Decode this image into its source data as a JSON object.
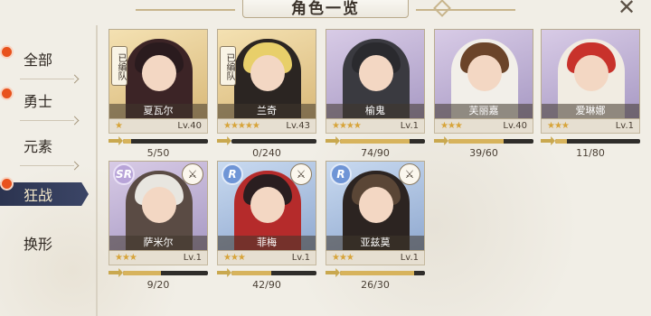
{
  "title": "角色一览",
  "close_icon": "close-icon",
  "sidebar": {
    "items": [
      {
        "label": "全部",
        "dot": true,
        "active": false
      },
      {
        "label": "勇士",
        "dot": true,
        "active": false
      },
      {
        "label": "元素",
        "dot": false,
        "active": false
      },
      {
        "label": "狂战",
        "dot": true,
        "active": true
      },
      {
        "label": "换形",
        "dot": false,
        "active": false
      }
    ]
  },
  "badge_text": "已编队",
  "characters": [
    {
      "name": "夏瓦尔",
      "stars": "★",
      "level": "Lv.40",
      "count": "5/50",
      "progress": 0.1,
      "formed": true,
      "frame": "gold",
      "rarity": "",
      "class_icon": false,
      "hair": "#2a1b1e",
      "outfit": "#3c2426"
    },
    {
      "name": "兰奇",
      "stars": "★★★★★",
      "level": "Lv.43",
      "count": "0/240",
      "progress": 0.0,
      "formed": true,
      "frame": "gold",
      "rarity": "",
      "class_icon": false,
      "hair": "#e8cf6a",
      "outfit": "#2b2522"
    },
    {
      "name": "榆鬼",
      "stars": "★★★★",
      "level": "Lv.1",
      "count": "74/90",
      "progress": 0.82,
      "formed": false,
      "frame": "purple",
      "rarity": "",
      "class_icon": false,
      "hair": "#2a2a2e",
      "outfit": "#3a3a40"
    },
    {
      "name": "芙丽嘉",
      "stars": "★★★",
      "level": "Lv.40",
      "count": "39/60",
      "progress": 0.65,
      "formed": false,
      "frame": "purple",
      "rarity": "",
      "class_icon": false,
      "hair": "#6b4429",
      "outfit": "#f2efe9"
    },
    {
      "name": "爱琳娜",
      "stars": "★★★",
      "level": "Lv.1",
      "count": "11/80",
      "progress": 0.14,
      "formed": false,
      "frame": "purple",
      "rarity": "",
      "class_icon": false,
      "hair": "#c8322b",
      "outfit": "#f1ece2"
    },
    {
      "name": "萨米尔",
      "stars": "★★★",
      "level": "Lv.1",
      "count": "9/20",
      "progress": 0.45,
      "formed": false,
      "frame": "purple",
      "rarity": "SR",
      "class_icon": true,
      "hair": "#e8e6e0",
      "outfit": "#5a4b44"
    },
    {
      "name": "菲梅",
      "stars": "★★★",
      "level": "Lv.1",
      "count": "42/90",
      "progress": 0.47,
      "formed": false,
      "frame": "blue",
      "rarity": "R",
      "class_icon": true,
      "hair": "#2a1e20",
      "outfit": "#b52b2b"
    },
    {
      "name": "亚兹莫",
      "stars": "★★★",
      "level": "Lv.1",
      "count": "26/30",
      "progress": 0.87,
      "formed": false,
      "frame": "blue",
      "rarity": "R",
      "class_icon": true,
      "hair": "#5a4636",
      "outfit": "#2c2421"
    }
  ],
  "class_icon_name": "axe-icon",
  "colors": {
    "accent": "#e8521d",
    "active_tab": "#2c3450",
    "progress": "#d7b35c"
  }
}
